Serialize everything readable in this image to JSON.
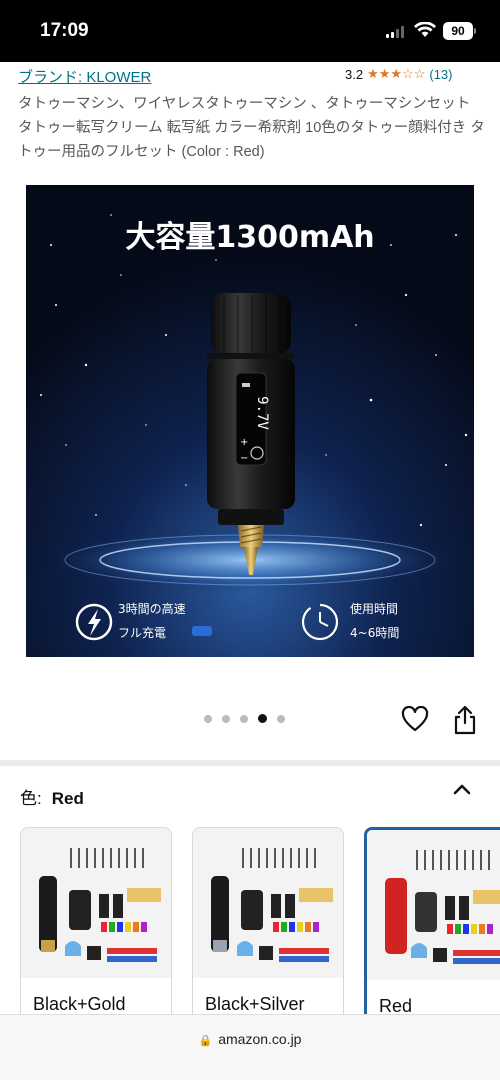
{
  "status_bar": {
    "time": "17:09",
    "battery": "90"
  },
  "header": {
    "brand": "ブランド: KLOWER",
    "rating_score": "3.2",
    "rating_value": 3.2,
    "rating_max": 5,
    "rating_count": "(13)"
  },
  "product": {
    "title": "タトゥーマシン、ワイヤレスタトゥーマシン 、タトゥーマシンセット タトゥー転写クリーム 転写紙 カラー希釈剤 10色のタトゥー顔料付き タトゥー用品のフルセット (Color : Red)",
    "image": {
      "headline": "大容量1300mAh",
      "display_reading": "9.7V",
      "feature_left_line1": "3時間の高速",
      "feature_left_line2": "フル充電",
      "feature_right_line1": "使用時間",
      "feature_right_line2": "4~6時間"
    }
  },
  "carousel": {
    "count": 5,
    "active_index": 3
  },
  "color_selector": {
    "label": "色:",
    "selected": "Red",
    "options": [
      {
        "name": "Black+Gold",
        "machine_color": "#1a1a1a",
        "accent": "#c8a04a"
      },
      {
        "name": "Black+Silver",
        "machine_color": "#1a1a1a",
        "accent": "#9aa3ad"
      },
      {
        "name": "Red",
        "machine_color": "#d22323",
        "accent": "#333333"
      }
    ]
  },
  "url_bar": {
    "domain": "amazon.co.jp"
  },
  "colors": {
    "link": "#007185",
    "star": "#de7921",
    "selected_border": "#2162a1"
  }
}
